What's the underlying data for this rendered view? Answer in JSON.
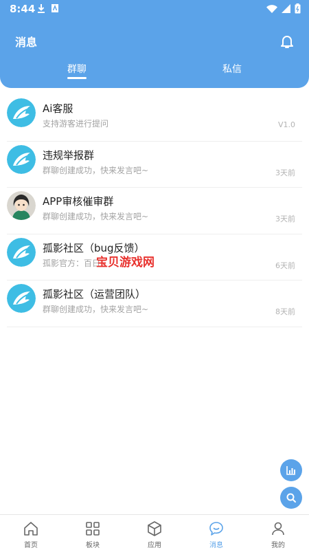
{
  "status_bar": {
    "time": "8:44"
  },
  "header": {
    "title": "消息"
  },
  "tabs": [
    {
      "label": "群聊",
      "active": true
    },
    {
      "label": "私信",
      "active": false
    }
  ],
  "conversations": [
    {
      "name": "Ai客服",
      "preview": "支持游客进行提问",
      "time": "V1.0",
      "avatar": "app-logo"
    },
    {
      "name": "违规举报群",
      "preview": "群聊创建成功，快来发言吧~",
      "time": "3天前",
      "avatar": "app-logo"
    },
    {
      "name": "APP审核催审群",
      "preview": "群聊创建成功，快来发言吧~",
      "time": "3天前",
      "avatar": "cartoon-girl"
    },
    {
      "name": "孤影社区（bug反馈）",
      "preview": "孤影官方：百日",
      "time": "6天前",
      "avatar": "app-logo"
    },
    {
      "name": "孤影社区（运营团队）",
      "preview": "群聊创建成功，快来发言吧~",
      "time": "8天前",
      "avatar": "app-logo"
    }
  ],
  "watermark": "宝贝游戏网",
  "bottom_nav": [
    {
      "label": "首页",
      "icon": "home-icon",
      "active": false
    },
    {
      "label": "板块",
      "icon": "grid-icon",
      "active": false
    },
    {
      "label": "应用",
      "icon": "cube-icon",
      "active": false
    },
    {
      "label": "消息",
      "icon": "chat-icon",
      "active": true
    },
    {
      "label": "我的",
      "icon": "user-icon",
      "active": false
    }
  ],
  "colors": {
    "accent": "#5ba3e9",
    "text": "#222222",
    "muted": "#a3a3a3"
  }
}
